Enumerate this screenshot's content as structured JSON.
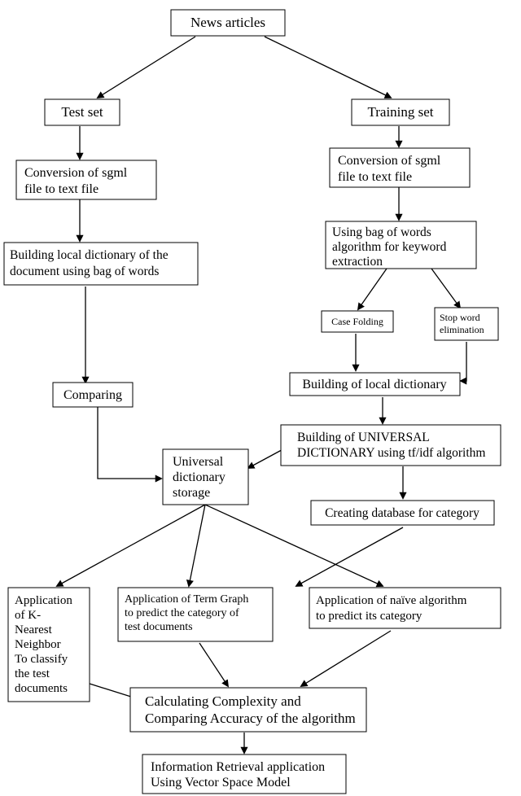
{
  "nodes": {
    "news_articles": "News articles",
    "test_set": "Test set",
    "training_set": "Training set",
    "conv_sgml_left": "Conversion of sgml file to text file",
    "conv_sgml_right": "Conversion of sgml file to text file",
    "build_local_left": "Building local dictionary of the document using bag of words",
    "bow_keyword": "Using bag of words algorithm for keyword extraction",
    "case_folding": "Case Folding",
    "stop_word": "Stop word elimination",
    "build_local_right": "Building of local dictionary",
    "universal_build": "Building of UNIVERSAL DICTIONARY using tf/idf algorithm",
    "comparing": "Comparing",
    "universal_storage": "Universal dictionary storage",
    "create_db": "Creating database for category",
    "knn": "Application of K-Nearest Neighbor To classify the test documents",
    "term_graph": "Application of Term Graph to predict the category of test documents",
    "naive": "Application of naïve algorithm to predict its category",
    "complexity": "Calculating Complexity and Comparing Accuracy of the algorithm",
    "ir_app": "Information Retrieval application Using Vector Space Model"
  }
}
